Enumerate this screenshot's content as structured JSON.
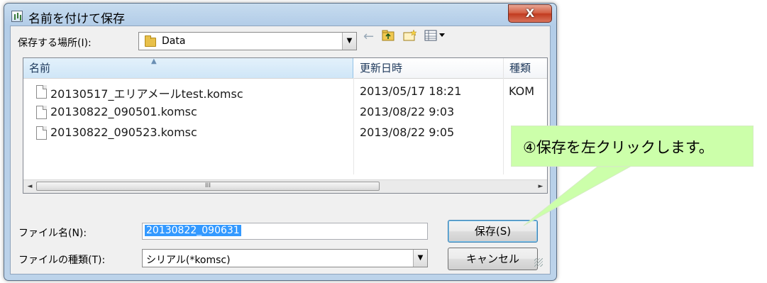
{
  "window": {
    "title": "名前を付けて保存",
    "close_label": "X"
  },
  "location": {
    "label": "保存する場所(I):",
    "value": "Data"
  },
  "file_list": {
    "columns": [
      "名前",
      "更新日時",
      "種類"
    ],
    "rows": [
      {
        "name": "20130517_エリアメールtest.komsc",
        "date": "2013/05/17 18:21",
        "type": "KOM"
      },
      {
        "name": "20130822_090501.komsc",
        "date": "2013/08/22 9:03",
        "type": ""
      },
      {
        "name": "20130822_090523.komsc",
        "date": "2013/08/22 9:05",
        "type": ""
      }
    ],
    "scroll_thumb": "III"
  },
  "filename": {
    "label": "ファイル名(N):",
    "value": "20130822_090631"
  },
  "filetype": {
    "label": "ファイルの種類(T):",
    "value": "シリアル(*komsc)"
  },
  "buttons": {
    "save": "保存(S)",
    "cancel": "キャンセル"
  },
  "callout": {
    "text": "④保存を左クリックします。"
  }
}
